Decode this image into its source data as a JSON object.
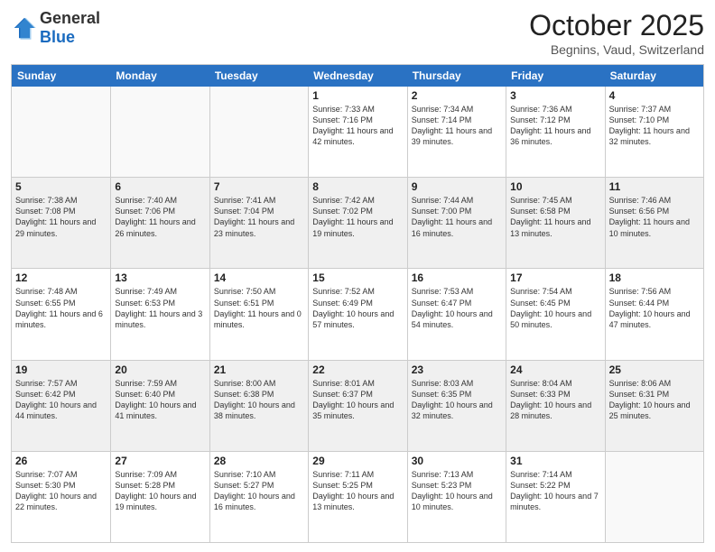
{
  "logo": {
    "general": "General",
    "blue": "Blue"
  },
  "title": "October 2025",
  "location": "Begnins, Vaud, Switzerland",
  "days_of_week": [
    "Sunday",
    "Monday",
    "Tuesday",
    "Wednesday",
    "Thursday",
    "Friday",
    "Saturday"
  ],
  "weeks": [
    [
      {
        "day": "",
        "sunrise": "",
        "sunset": "",
        "daylight": "",
        "empty": true
      },
      {
        "day": "",
        "sunrise": "",
        "sunset": "",
        "daylight": "",
        "empty": true
      },
      {
        "day": "",
        "sunrise": "",
        "sunset": "",
        "daylight": "",
        "empty": true
      },
      {
        "day": "1",
        "sunrise": "Sunrise: 7:33 AM",
        "sunset": "Sunset: 7:16 PM",
        "daylight": "Daylight: 11 hours and 42 minutes."
      },
      {
        "day": "2",
        "sunrise": "Sunrise: 7:34 AM",
        "sunset": "Sunset: 7:14 PM",
        "daylight": "Daylight: 11 hours and 39 minutes."
      },
      {
        "day": "3",
        "sunrise": "Sunrise: 7:36 AM",
        "sunset": "Sunset: 7:12 PM",
        "daylight": "Daylight: 11 hours and 36 minutes."
      },
      {
        "day": "4",
        "sunrise": "Sunrise: 7:37 AM",
        "sunset": "Sunset: 7:10 PM",
        "daylight": "Daylight: 11 hours and 32 minutes."
      }
    ],
    [
      {
        "day": "5",
        "sunrise": "Sunrise: 7:38 AM",
        "sunset": "Sunset: 7:08 PM",
        "daylight": "Daylight: 11 hours and 29 minutes."
      },
      {
        "day": "6",
        "sunrise": "Sunrise: 7:40 AM",
        "sunset": "Sunset: 7:06 PM",
        "daylight": "Daylight: 11 hours and 26 minutes."
      },
      {
        "day": "7",
        "sunrise": "Sunrise: 7:41 AM",
        "sunset": "Sunset: 7:04 PM",
        "daylight": "Daylight: 11 hours and 23 minutes."
      },
      {
        "day": "8",
        "sunrise": "Sunrise: 7:42 AM",
        "sunset": "Sunset: 7:02 PM",
        "daylight": "Daylight: 11 hours and 19 minutes."
      },
      {
        "day": "9",
        "sunrise": "Sunrise: 7:44 AM",
        "sunset": "Sunset: 7:00 PM",
        "daylight": "Daylight: 11 hours and 16 minutes."
      },
      {
        "day": "10",
        "sunrise": "Sunrise: 7:45 AM",
        "sunset": "Sunset: 6:58 PM",
        "daylight": "Daylight: 11 hours and 13 minutes."
      },
      {
        "day": "11",
        "sunrise": "Sunrise: 7:46 AM",
        "sunset": "Sunset: 6:56 PM",
        "daylight": "Daylight: 11 hours and 10 minutes."
      }
    ],
    [
      {
        "day": "12",
        "sunrise": "Sunrise: 7:48 AM",
        "sunset": "Sunset: 6:55 PM",
        "daylight": "Daylight: 11 hours and 6 minutes."
      },
      {
        "day": "13",
        "sunrise": "Sunrise: 7:49 AM",
        "sunset": "Sunset: 6:53 PM",
        "daylight": "Daylight: 11 hours and 3 minutes."
      },
      {
        "day": "14",
        "sunrise": "Sunrise: 7:50 AM",
        "sunset": "Sunset: 6:51 PM",
        "daylight": "Daylight: 11 hours and 0 minutes."
      },
      {
        "day": "15",
        "sunrise": "Sunrise: 7:52 AM",
        "sunset": "Sunset: 6:49 PM",
        "daylight": "Daylight: 10 hours and 57 minutes."
      },
      {
        "day": "16",
        "sunrise": "Sunrise: 7:53 AM",
        "sunset": "Sunset: 6:47 PM",
        "daylight": "Daylight: 10 hours and 54 minutes."
      },
      {
        "day": "17",
        "sunrise": "Sunrise: 7:54 AM",
        "sunset": "Sunset: 6:45 PM",
        "daylight": "Daylight: 10 hours and 50 minutes."
      },
      {
        "day": "18",
        "sunrise": "Sunrise: 7:56 AM",
        "sunset": "Sunset: 6:44 PM",
        "daylight": "Daylight: 10 hours and 47 minutes."
      }
    ],
    [
      {
        "day": "19",
        "sunrise": "Sunrise: 7:57 AM",
        "sunset": "Sunset: 6:42 PM",
        "daylight": "Daylight: 10 hours and 44 minutes."
      },
      {
        "day": "20",
        "sunrise": "Sunrise: 7:59 AM",
        "sunset": "Sunset: 6:40 PM",
        "daylight": "Daylight: 10 hours and 41 minutes."
      },
      {
        "day": "21",
        "sunrise": "Sunrise: 8:00 AM",
        "sunset": "Sunset: 6:38 PM",
        "daylight": "Daylight: 10 hours and 38 minutes."
      },
      {
        "day": "22",
        "sunrise": "Sunrise: 8:01 AM",
        "sunset": "Sunset: 6:37 PM",
        "daylight": "Daylight: 10 hours and 35 minutes."
      },
      {
        "day": "23",
        "sunrise": "Sunrise: 8:03 AM",
        "sunset": "Sunset: 6:35 PM",
        "daylight": "Daylight: 10 hours and 32 minutes."
      },
      {
        "day": "24",
        "sunrise": "Sunrise: 8:04 AM",
        "sunset": "Sunset: 6:33 PM",
        "daylight": "Daylight: 10 hours and 28 minutes."
      },
      {
        "day": "25",
        "sunrise": "Sunrise: 8:06 AM",
        "sunset": "Sunset: 6:31 PM",
        "daylight": "Daylight: 10 hours and 25 minutes."
      }
    ],
    [
      {
        "day": "26",
        "sunrise": "Sunrise: 7:07 AM",
        "sunset": "Sunset: 5:30 PM",
        "daylight": "Daylight: 10 hours and 22 minutes."
      },
      {
        "day": "27",
        "sunrise": "Sunrise: 7:09 AM",
        "sunset": "Sunset: 5:28 PM",
        "daylight": "Daylight: 10 hours and 19 minutes."
      },
      {
        "day": "28",
        "sunrise": "Sunrise: 7:10 AM",
        "sunset": "Sunset: 5:27 PM",
        "daylight": "Daylight: 10 hours and 16 minutes."
      },
      {
        "day": "29",
        "sunrise": "Sunrise: 7:11 AM",
        "sunset": "Sunset: 5:25 PM",
        "daylight": "Daylight: 10 hours and 13 minutes."
      },
      {
        "day": "30",
        "sunrise": "Sunrise: 7:13 AM",
        "sunset": "Sunset: 5:23 PM",
        "daylight": "Daylight: 10 hours and 10 minutes."
      },
      {
        "day": "31",
        "sunrise": "Sunrise: 7:14 AM",
        "sunset": "Sunset: 5:22 PM",
        "daylight": "Daylight: 10 hours and 7 minutes."
      },
      {
        "day": "",
        "sunrise": "",
        "sunset": "",
        "daylight": "",
        "empty": true
      }
    ]
  ]
}
